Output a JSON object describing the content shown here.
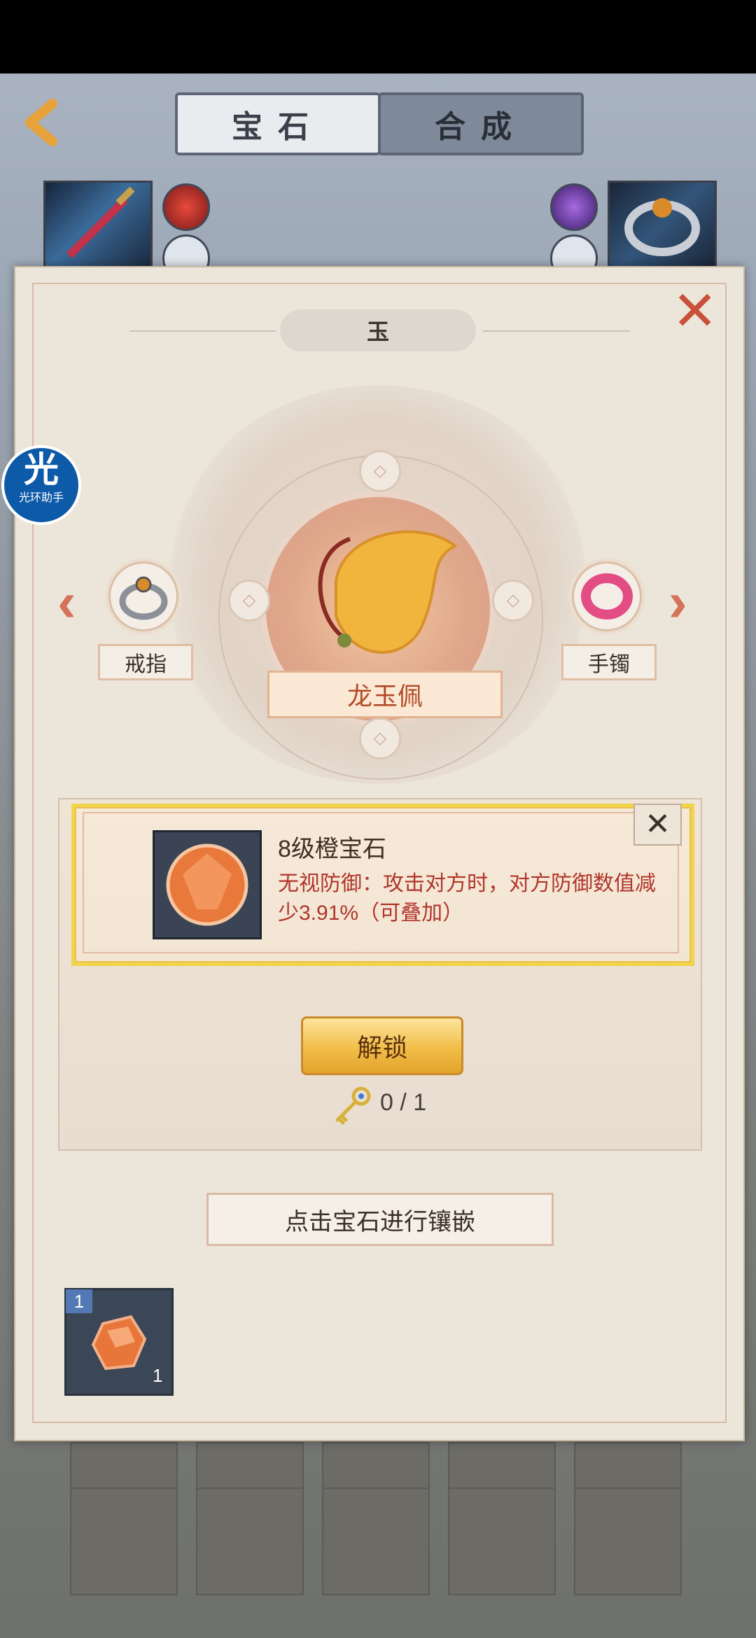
{
  "tabs": [
    {
      "label": "宝石"
    },
    {
      "label": "合成"
    }
  ],
  "panel": {
    "title": "玉",
    "left_item": {
      "label": "戒指"
    },
    "center_item": {
      "label": "龙玉佩"
    },
    "right_item": {
      "label": "手镯"
    }
  },
  "gem_card": {
    "name": "8级橙宝石",
    "description": "无视防御：攻击对方时，对方防御数值减少3.91%（可叠加）"
  },
  "unlock": {
    "button_label": "解锁",
    "key_count": "0 / 1"
  },
  "hint": "点击宝石进行镶嵌",
  "inventory": [
    {
      "badge": "1",
      "count": "1"
    }
  ],
  "helper": {
    "glyph": "光",
    "label": "光环助手"
  },
  "icons": [
    "back-arrow-icon",
    "close-icon",
    "weapon-icon",
    "ring-icon",
    "jade-pendant-icon",
    "bracelet-icon",
    "orange-gem-icon",
    "key-icon"
  ],
  "colors": {
    "accent_red": "#c9503a",
    "gold_button": "#f1be47",
    "gem_card_border": "#f1d44c",
    "desc_text": "#b1352a"
  }
}
